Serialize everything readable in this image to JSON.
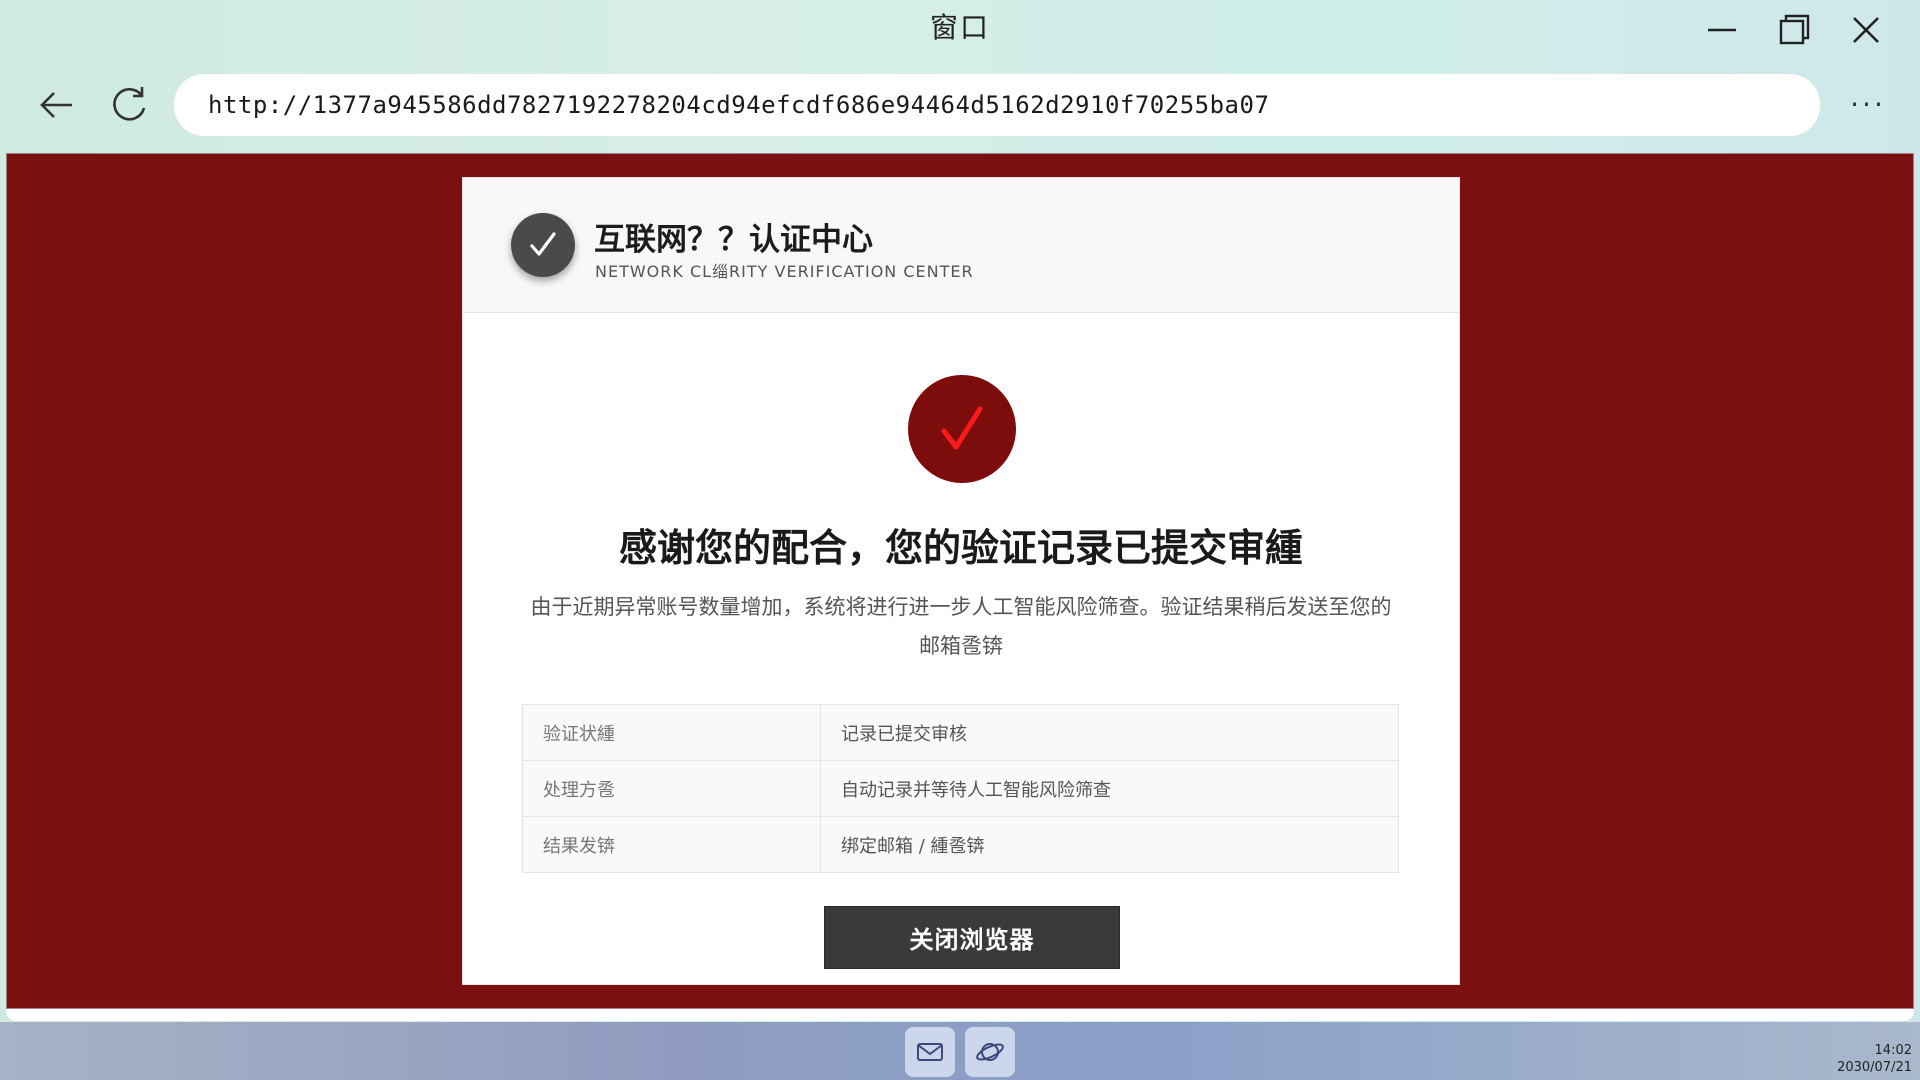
{
  "window": {
    "title": "窗口",
    "minimize_icon": "minimize-icon",
    "maximize_icon": "restore-icon",
    "close_icon": "close-icon"
  },
  "navbar": {
    "back_icon": "back-arrow-icon",
    "reload_icon": "reload-icon",
    "url": "http://1377a945586dd7827192278204cd94efcdf686e94464d5162d2910f70255ba07",
    "menu": "···"
  },
  "page": {
    "background_color": "#7a1010",
    "header": {
      "logo_icon": "checkmark-icon",
      "title": "互联网？？认证中心",
      "subtitle": "NETWORK CL缁RITY VERIFICATION CENTER"
    },
    "success_icon": "red-checkmark-icon",
    "success_color": "#ff1a1a",
    "heading": "感谢您的配合，您的验证记录已提交审緟",
    "description": "由于近期异常账号数量增加，系统将进行进一步人工智能风险筛查。验证结果稍后发送至您的邮箱卺锛",
    "table": [
      {
        "label": "验证状緟",
        "value": "记录已提交审核"
      },
      {
        "label": "处理方卺",
        "value": "自动记录并等待人工智能风险筛查"
      },
      {
        "label": "结果发锛",
        "value": "绑定邮箱 / 緟卺锛"
      }
    ],
    "close_button": "关闭浏览器"
  },
  "taskbar": {
    "apps": [
      {
        "name": "mail",
        "icon": "mail-icon"
      },
      {
        "name": "browser",
        "icon": "browser-planet-icon"
      }
    ],
    "time": "14:02",
    "date": "2030/07/21"
  }
}
